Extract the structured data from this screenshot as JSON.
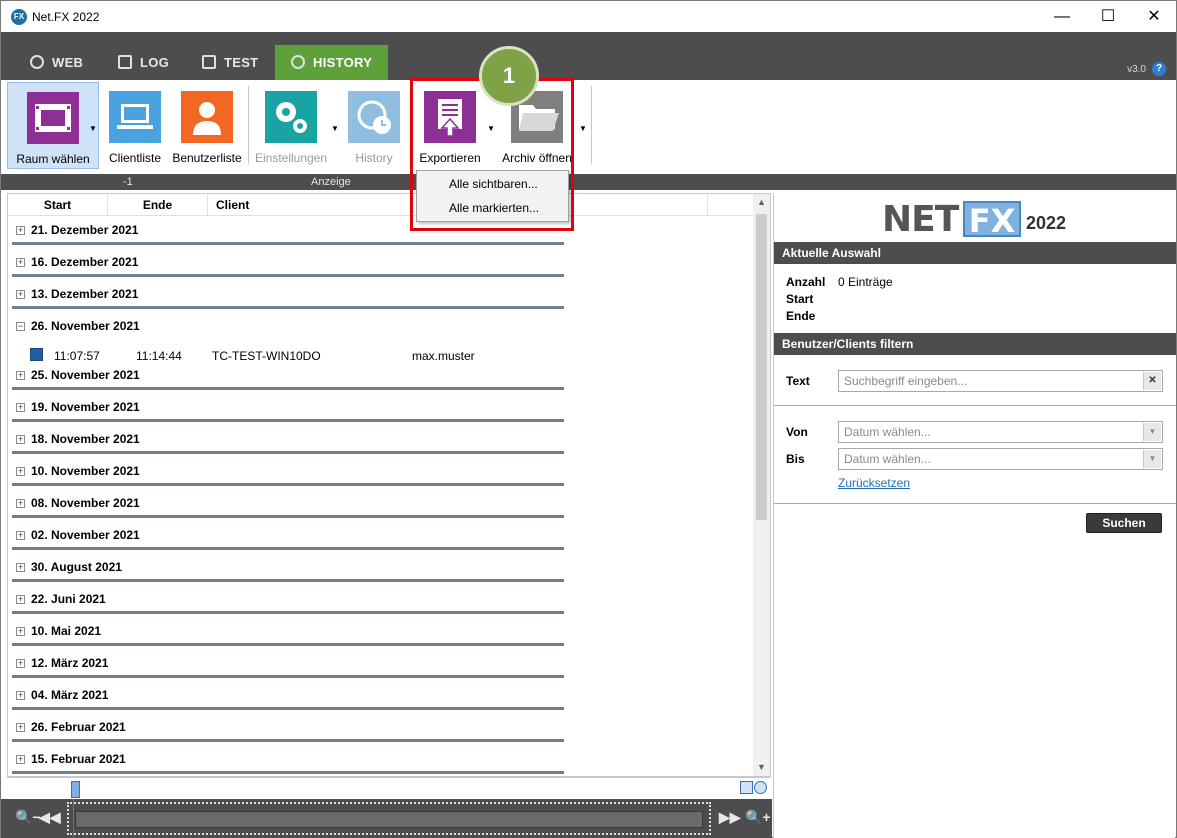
{
  "window": {
    "title": "Net.FX 2022",
    "app_icon": "FX",
    "minimize": "—",
    "maximize": "☐",
    "close": "✕"
  },
  "tabs": [
    {
      "label": "WEB",
      "icon": "globe-icon"
    },
    {
      "label": "LOG",
      "icon": "log-icon"
    },
    {
      "label": "TEST",
      "icon": "test-icon"
    },
    {
      "label": "HISTORY",
      "icon": "history-icon",
      "active": true
    }
  ],
  "version": "v3.0",
  "help": "?",
  "ribbon": {
    "buttons": {
      "raum": "Raum wählen",
      "clientliste": "Clientliste",
      "benutzerliste": "Benutzerliste",
      "einstellungen": "Einstellungen",
      "history": "History",
      "exportieren": "Exportieren",
      "archiv": "Archiv öffnen"
    },
    "group_left": "-1",
    "group_anzeige": "Anzeige",
    "dropdown_arrow": "▼"
  },
  "badge": "1",
  "export_menu": {
    "visible": "Alle sichtbaren...",
    "marked": "Alle markierten..."
  },
  "list": {
    "columns": {
      "start": "Start",
      "ende": "Ende",
      "client": "Client"
    },
    "groups": [
      {
        "label": "21. Dezember 2021",
        "toggle": "+"
      },
      {
        "label": "16. Dezember 2021",
        "toggle": "+"
      },
      {
        "label": "13. Dezember 2021",
        "toggle": "+"
      },
      {
        "label": "26. November 2021",
        "toggle": "−"
      },
      {
        "label": "25. November 2021",
        "toggle": "+"
      },
      {
        "label": "19. November 2021",
        "toggle": "+"
      },
      {
        "label": "18. November 2021",
        "toggle": "+"
      },
      {
        "label": "10. November 2021",
        "toggle": "+"
      },
      {
        "label": "08. November 2021",
        "toggle": "+"
      },
      {
        "label": "02. November 2021",
        "toggle": "+"
      },
      {
        "label": "30. August 2021",
        "toggle": "+"
      },
      {
        "label": "22. Juni 2021",
        "toggle": "+"
      },
      {
        "label": "10. Mai 2021",
        "toggle": "+"
      },
      {
        "label": "12. März 2021",
        "toggle": "+"
      },
      {
        "label": "04. März 2021",
        "toggle": "+"
      },
      {
        "label": "26. Februar 2021",
        "toggle": "+"
      },
      {
        "label": "15. Februar 2021",
        "toggle": "+"
      }
    ],
    "entry": {
      "start": "11:07:57",
      "end": "11:14:44",
      "client": "TC-TEST-WIN10DO",
      "user": "max.muster"
    },
    "scroll_up": "▲",
    "scroll_down": "▼"
  },
  "nav": {
    "zoom_out": "🔍−",
    "back": "◀◀",
    "forward": "▶▶",
    "zoom_in": "🔍+"
  },
  "right": {
    "logo_net": "NET",
    "logo_fx": "FX",
    "logo_year": "2022",
    "aktuell_title": "Aktuelle Auswahl",
    "anzahl_label": "Anzahl",
    "anzahl_value": "0 Einträge",
    "start_label": "Start",
    "ende_label": "Ende",
    "filter_title": "Benutzer/Clients filtern",
    "text_label": "Text",
    "text_placeholder": "Suchbegriff eingeben...",
    "clear": "✕",
    "von_label": "Von",
    "bis_label": "Bis",
    "date_placeholder": "Datum wählen...",
    "select_arrow": "▼",
    "reset": "Zurücksetzen",
    "search_button": "Suchen"
  }
}
